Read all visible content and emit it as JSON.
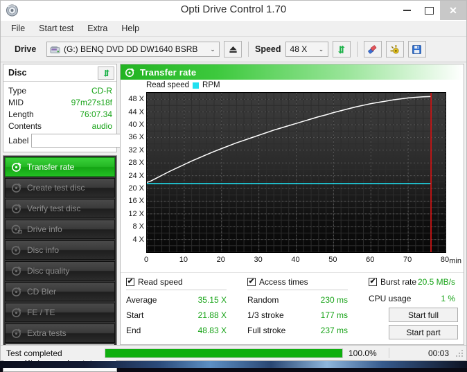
{
  "window": {
    "title": "Opti Drive Control 1.70",
    "app_icon": "disc-icon",
    "minimize": "minimize-icon",
    "maximize": "maximize-icon",
    "close": "close-icon"
  },
  "menu": {
    "items": [
      {
        "label": "File"
      },
      {
        "label": "Start test"
      },
      {
        "label": "Extra"
      },
      {
        "label": "Help"
      }
    ]
  },
  "toolbar": {
    "drive_label": "Drive",
    "drive_value": "(G:)   BENQ DVD DD DW1640 BSRB",
    "drive_icon": "drive-icon",
    "eject_icon": "eject-icon",
    "speed_label": "Speed",
    "speed_value": "48 X",
    "refresh_icon": "refresh-icon",
    "eraser_icon": "eraser-icon",
    "settings_icon": "settings-icon",
    "save_icon": "save-icon",
    "dropdown_icon": "chevron-down-icon"
  },
  "disc_panel": {
    "title": "Disc",
    "refresh_icon": "refresh-icon",
    "rows": [
      {
        "key": "Type",
        "value": "CD-R"
      },
      {
        "key": "MID",
        "value": "97m27s18f"
      },
      {
        "key": "Length",
        "value": "76:07.34"
      },
      {
        "key": "Contents",
        "value": "audio"
      }
    ],
    "label_key": "Label",
    "label_value": "",
    "label_placeholder": "",
    "label_icon": "cd-icon"
  },
  "nav": {
    "items": [
      {
        "label": "Transfer rate",
        "icon": "disc-test-icon",
        "active": true
      },
      {
        "label": "Create test disc",
        "icon": "disc-test-icon",
        "active": false
      },
      {
        "label": "Verify test disc",
        "icon": "disc-test-icon",
        "active": false
      },
      {
        "label": "Drive info",
        "icon": "disc-info-icon",
        "active": false
      },
      {
        "label": "Disc info",
        "icon": "disc-info-icon",
        "active": false
      },
      {
        "label": "Disc quality",
        "icon": "disc-test-icon",
        "active": false
      },
      {
        "label": "CD Bler",
        "icon": "disc-test-icon",
        "active": false
      },
      {
        "label": "FE / TE",
        "icon": "disc-test-icon",
        "active": false
      },
      {
        "label": "Extra tests",
        "icon": "disc-test-icon",
        "active": false
      }
    ],
    "status_window_button": "Status window > >"
  },
  "panel_header": {
    "title": "Transfer rate",
    "icon": "disc-test-icon"
  },
  "chart_data": {
    "type": "line",
    "title": "Transfer rate",
    "xlabel": "min",
    "ylabel": "X",
    "xlim": [
      0,
      80
    ],
    "ylim": [
      0,
      50
    ],
    "grid": true,
    "legend_position": "top-left",
    "x_ticks": [
      0,
      10,
      20,
      30,
      40,
      50,
      60,
      70,
      80
    ],
    "y_ticks": [
      4,
      8,
      12,
      16,
      20,
      24,
      28,
      32,
      36,
      40,
      44,
      48
    ],
    "y_tick_labels": [
      "4 X",
      "8 X",
      "12 X",
      "16 X",
      "20 X",
      "24 X",
      "28 X",
      "32 X",
      "36 X",
      "40 X",
      "44 X",
      "48 X"
    ],
    "x_unit": "min",
    "legend": [
      {
        "name": "Read speed",
        "color": "#ffffff"
      },
      {
        "name": "RPM",
        "color": "#20e0f0"
      }
    ],
    "marker_line": {
      "x": 76.12,
      "color": "#e01010",
      "name": "disc-end-marker"
    },
    "series": [
      {
        "name": "Read speed",
        "color": "#ffffff",
        "x": [
          0,
          1,
          2,
          3,
          4,
          5,
          6,
          8,
          10,
          12,
          14,
          16,
          18,
          20,
          22,
          24,
          26,
          28,
          30,
          32,
          34,
          36,
          38,
          40,
          42,
          44,
          46,
          48,
          50,
          52,
          54,
          56,
          58,
          60,
          62,
          64,
          66,
          68,
          70,
          72,
          74,
          76.12
        ],
        "y": [
          21.88,
          22.3,
          22.9,
          23.5,
          24.1,
          24.7,
          25.3,
          26.4,
          27.5,
          28.6,
          29.6,
          30.6,
          31.6,
          32.5,
          33.4,
          34.3,
          35.1,
          35.9,
          36.7,
          37.5,
          38.3,
          39.0,
          39.7,
          40.4,
          41.1,
          41.8,
          42.5,
          43.1,
          43.8,
          44.4,
          45.0,
          45.6,
          46.1,
          46.6,
          47.0,
          47.4,
          47.8,
          48.1,
          48.4,
          48.6,
          48.75,
          48.83
        ]
      },
      {
        "name": "RPM",
        "color": "#20e0f0",
        "x": [
          0,
          5,
          10,
          15,
          20,
          25,
          30,
          35,
          40,
          45,
          50,
          55,
          60,
          65,
          70,
          76.12
        ],
        "y": [
          21.5,
          21.5,
          21.5,
          21.5,
          21.5,
          21.5,
          21.5,
          21.5,
          21.5,
          21.5,
          21.5,
          21.5,
          21.5,
          21.5,
          21.5,
          21.5
        ]
      }
    ]
  },
  "stats": {
    "read_speed": {
      "checkbox_label": "Read speed",
      "checked": true,
      "rows": [
        {
          "key": "Average",
          "value": "35.15 X"
        },
        {
          "key": "Start",
          "value": "21.88 X"
        },
        {
          "key": "End",
          "value": "48.83 X"
        }
      ]
    },
    "access_times": {
      "checkbox_label": "Access times",
      "checked": true,
      "rows": [
        {
          "key": "Random",
          "value": "230 ms"
        },
        {
          "key": "1/3 stroke",
          "value": "177 ms"
        },
        {
          "key": "Full stroke",
          "value": "237 ms"
        }
      ]
    },
    "burst": {
      "checkbox_label": "Burst rate",
      "checked": true,
      "burst_value": "20.5 MB/s",
      "cpu_key": "CPU usage",
      "cpu_value": "1 %",
      "start_full": "Start full",
      "start_part": "Start part"
    }
  },
  "statusbar": {
    "text": "Test completed",
    "progress_percent": 100,
    "progress_label": "100.0%",
    "elapsed": "00:03",
    "grip_icon": "resize-grip-icon"
  }
}
